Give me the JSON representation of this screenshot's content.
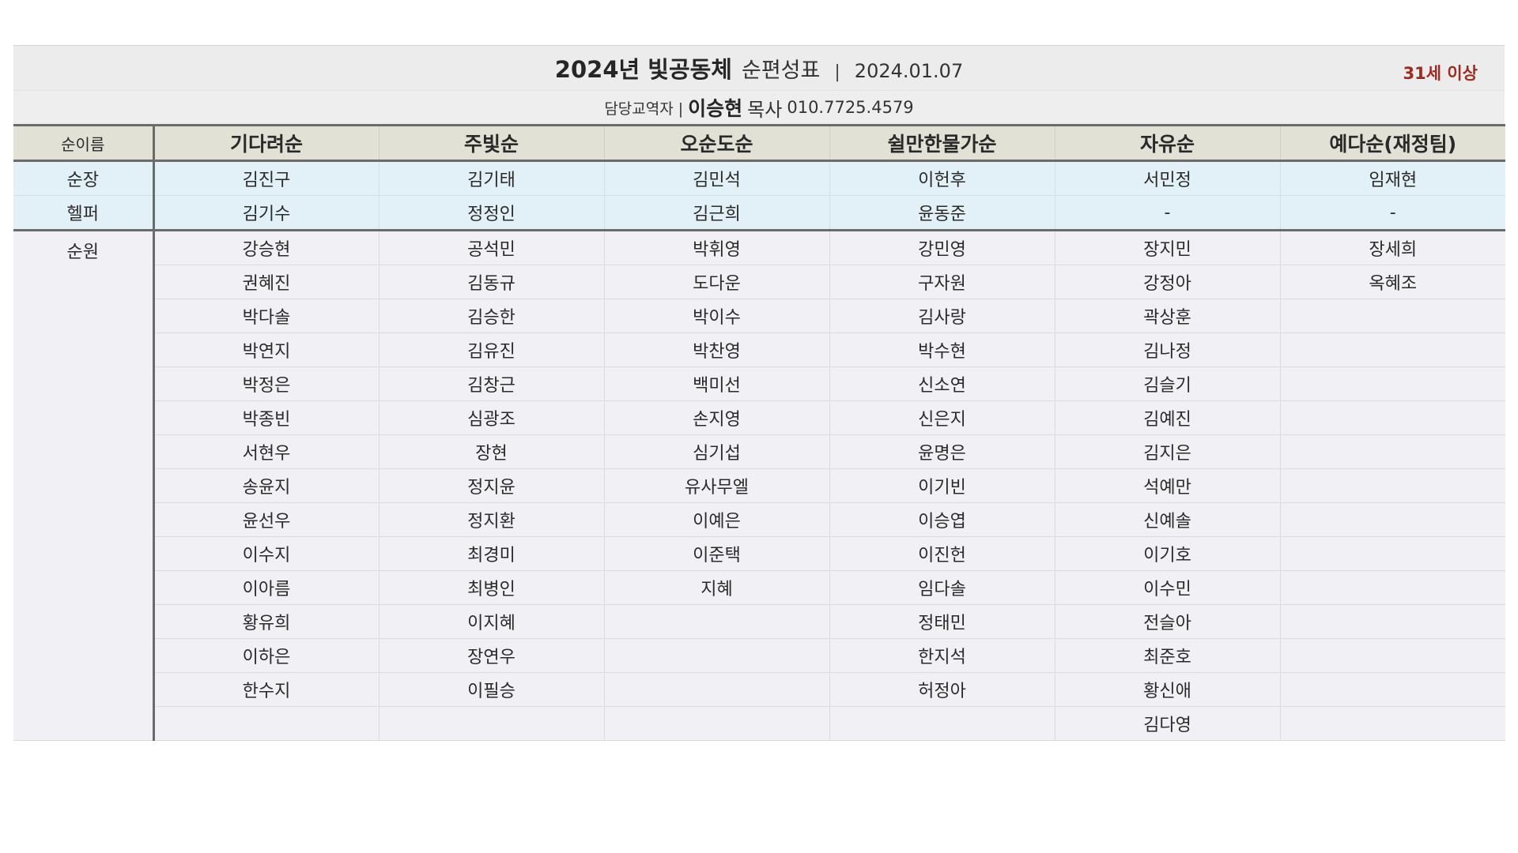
{
  "header": {
    "title_bold": "2024년 빛공동체",
    "title_normal": "순편성표",
    "separator": "|",
    "date": "2024.01.07",
    "age_badge": "31세 이상",
    "contact_label": "담당교역자 |",
    "contact_name": "이승현",
    "contact_title": "목사",
    "contact_phone": "010.7725.4579"
  },
  "table": {
    "corner_label": "순이름",
    "columns": [
      "기다려순",
      "주빛순",
      "오순도순",
      "쉴만한물가순",
      "자유순",
      "예다순(재정팀)"
    ],
    "leaders": [
      {
        "role": "순장",
        "cells": [
          "김진구",
          "김기태",
          "김민석",
          "이헌후",
          "서민정",
          "임재현"
        ]
      },
      {
        "role": "헬퍼",
        "cells": [
          "김기수",
          "정정인",
          "김근희",
          "윤동준",
          "-",
          "-"
        ]
      }
    ],
    "members_role": "순원",
    "members": [
      [
        "강승현",
        "공석민",
        "박휘영",
        "강민영",
        "장지민",
        "장세희"
      ],
      [
        "권혜진",
        "김동규",
        "도다운",
        "구자원",
        "강정아",
        "옥혜조"
      ],
      [
        "박다솔",
        "김승한",
        "박이수",
        "김사랑",
        "곽상훈",
        ""
      ],
      [
        "박연지",
        "김유진",
        "박찬영",
        "박수현",
        "김나정",
        ""
      ],
      [
        "박정은",
        "김창근",
        "백미선",
        "신소연",
        "김슬기",
        ""
      ],
      [
        "박종빈",
        "심광조",
        "손지영",
        "신은지",
        "김예진",
        ""
      ],
      [
        "서현우",
        "장현",
        "심기섭",
        "윤명은",
        "김지은",
        ""
      ],
      [
        "송윤지",
        "정지윤",
        "유사무엘",
        "이기빈",
        "석예만",
        ""
      ],
      [
        "윤선우",
        "정지환",
        "이예은",
        "이승엽",
        "신예솔",
        ""
      ],
      [
        "이수지",
        "최경미",
        "이준택",
        "이진헌",
        "이기호",
        ""
      ],
      [
        "이아름",
        "최병인",
        "지혜",
        "임다솔",
        "이수민",
        ""
      ],
      [
        "황유희",
        "이지혜",
        "",
        "정태민",
        "전슬아",
        ""
      ],
      [
        "이하은",
        "장연우",
        "",
        "한지석",
        "최준호",
        ""
      ],
      [
        "한수지",
        "이필승",
        "",
        "허정아",
        "황신애",
        ""
      ],
      [
        "",
        "",
        "",
        "",
        "김다영",
        ""
      ]
    ]
  }
}
